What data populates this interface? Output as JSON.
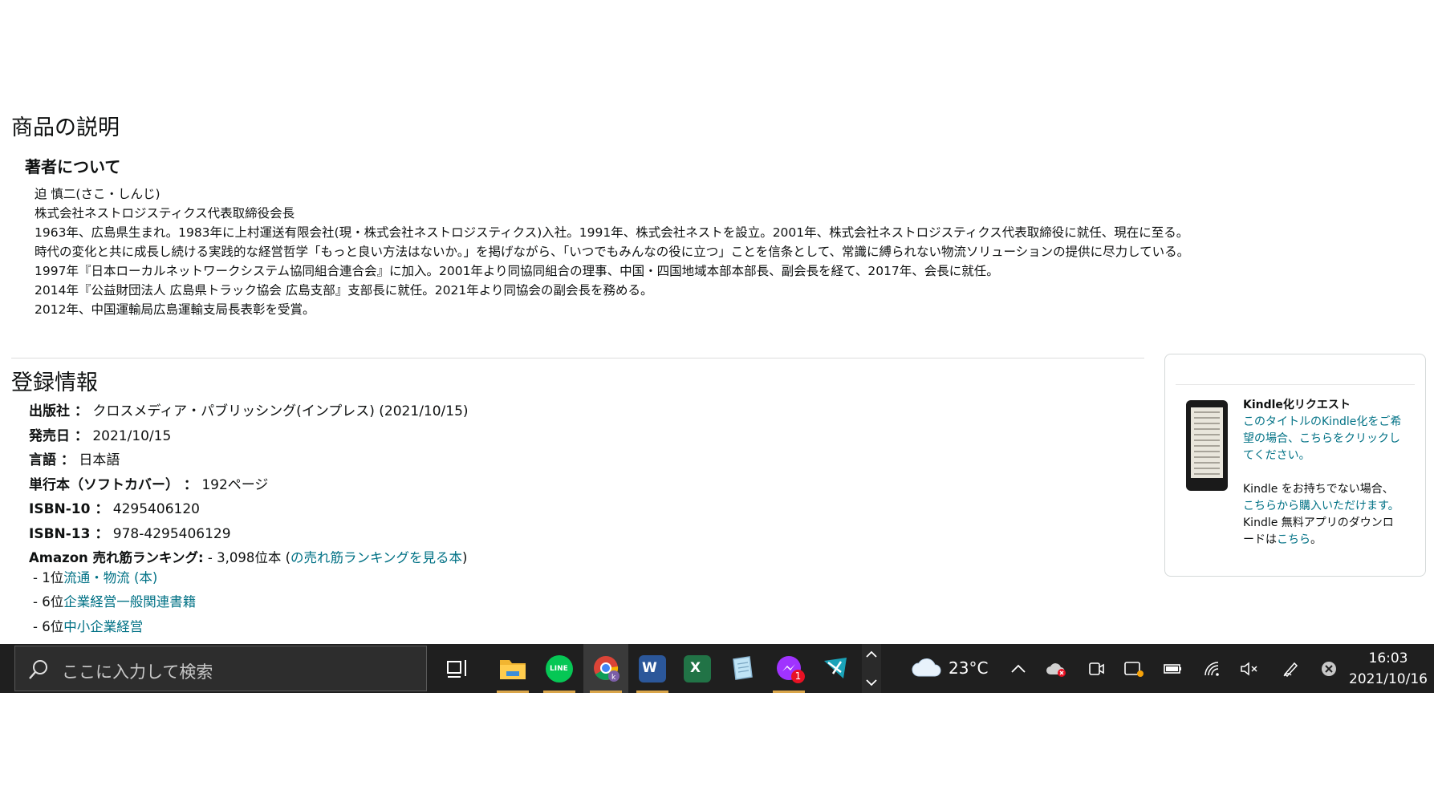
{
  "description_section": {
    "title": "商品の説明",
    "subtitle": "著者について",
    "lines": [
      "迫 慎二(さこ・しんじ)",
      "株式会社ネストロジスティクス代表取締役会長",
      "1963年、広島県生まれ。1983年に上村運送有限会社(現・株式会社ネストロジスティクス)入社。1991年、株式会社ネストを設立。2001年、株式会社ネストロジスティクス代表取締役に就任、現在に至る。",
      "時代の変化と共に成長し続ける実践的な経営哲学「もっと良い方法はないか。」を掲げながら、「いつでもみんなの役に立つ」ことを信条として、常識に縛られない物流ソリューションの提供に尽力している。",
      "1997年『日本ローカルネットワークシステム協同組合連合会』に加入。2001年より同協同組合の理事、中国・四国地域本部本部長、副会長を経て、2017年、会長に就任。",
      "2014年『公益財団法人 広島県トラック協会 広島支部』支部長に就任。2021年より同協会の副会長を務める。",
      "2012年、中国運輸局広島運輸支局長表彰を受賞。"
    ]
  },
  "details_section": {
    "title": "登録情報",
    "publisher": {
      "key": "出版社 ：",
      "value": "クロスメディア・パブリッシング(インプレス) (2021/10/15)"
    },
    "release_date": {
      "key": "発売日 ：",
      "value": "2021/10/15"
    },
    "language": {
      "key": "言語 ：",
      "value": "日本語"
    },
    "format": {
      "key": "単行本（ソフトカバー） ：",
      "value": "192ページ"
    },
    "isbn10": {
      "key": "ISBN-10 ：",
      "value": "4295406120"
    },
    "isbn13": {
      "key": "ISBN-13 ：",
      "value": "978-4295406129"
    },
    "ranking": {
      "key": "Amazon 売れ筋ランキング:",
      "value": "- 3,098位本 (",
      "link": "の売れ筋ランキングを見る本",
      "close": ")"
    },
    "sub_rankings": [
      {
        "prefix": "- 1位",
        "link": "流通・物流 (本)"
      },
      {
        "prefix": "- 6位",
        "link": "企業経営一般関連書籍"
      },
      {
        "prefix": "- 6位",
        "link": "中小企業経営"
      }
    ]
  },
  "kindle_card": {
    "title": "Kindle化リクエスト",
    "request_link_lines": [
      "このタイトルのKindle化をご希",
      "望の場合、こちらをクリックし",
      "てください。"
    ],
    "no_kindle_line": "Kindle をお持ちでない場合、",
    "buy_link": "こちらから購入いただけます。",
    "app_line1": "Kindle 無料アプリのダウンロ",
    "app_line2_prefix": "ードは",
    "app_link": "こちら",
    "app_line2_suffix": "。"
  },
  "taskbar": {
    "search_placeholder": "ここに入力して検索",
    "weather_temp": "23°C",
    "time": "16:03",
    "date": "2021/10/16",
    "badge_count": "1"
  }
}
